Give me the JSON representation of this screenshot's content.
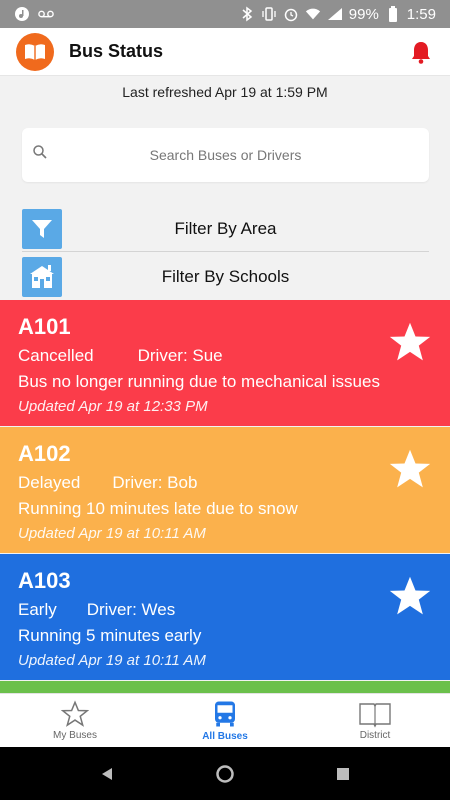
{
  "status_bar": {
    "battery": "99%",
    "time": "1:59"
  },
  "app": {
    "title": "Bus Status"
  },
  "refresh": {
    "text": "Last refreshed Apr 19 at 1:59 PM"
  },
  "search": {
    "placeholder": "Search Buses or Drivers",
    "value": ""
  },
  "filters": {
    "area_label": "Filter By Area",
    "schools_label": "Filter By Schools"
  },
  "buses": [
    {
      "name": "A101",
      "status": "Cancelled",
      "driver": "Driver: Sue",
      "message": "Bus no longer running due to mechanical issues",
      "updated": "Updated Apr 19 at 12:33 PM",
      "color": "#fb3c4a"
    },
    {
      "name": "A102",
      "status": "Delayed",
      "driver": "Driver: Bob",
      "message": "Running 10 minutes late due to snow",
      "updated": "Updated Apr 19 at 10:11 AM",
      "color": "#fbb14c"
    },
    {
      "name": "A103",
      "status": "Early",
      "driver": "Driver: Wes",
      "message": "Running 5 minutes early",
      "updated": "Updated Apr 19 at 10:11 AM",
      "color": "#1f6fdf"
    }
  ],
  "bottom_nav": {
    "items": [
      {
        "label": "My Buses",
        "icon": "star-outline-icon"
      },
      {
        "label": "All Buses",
        "icon": "bus-icon",
        "active": true
      },
      {
        "label": "District",
        "icon": "book-icon"
      }
    ]
  },
  "colors": {
    "accent": "#2378e6",
    "logo": "#f06a1d",
    "bell": "#e31b23",
    "filter_icon": "#5aa9e6"
  }
}
